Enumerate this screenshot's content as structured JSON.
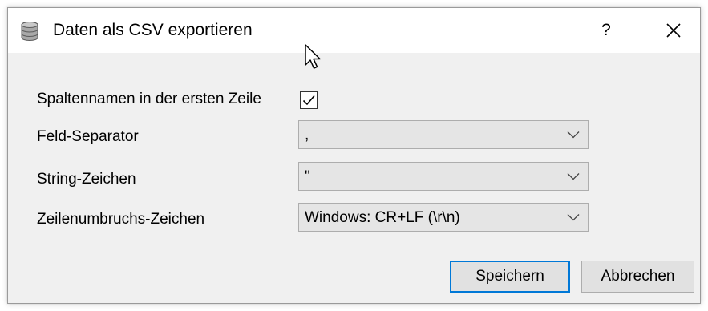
{
  "window": {
    "title": "Daten als CSV exportieren",
    "help_label": "?",
    "title_icon": "database-icon",
    "close_icon": "close-icon"
  },
  "form": {
    "header_row": {
      "label": "Spaltennamen in der ersten Zeile",
      "checked": true
    },
    "field_separator": {
      "label": "Feld-Separator",
      "value": ","
    },
    "string_char": {
      "label": "String-Zeichen",
      "value": "\""
    },
    "line_break": {
      "label": "Zeilenumbruchs-Zeichen",
      "value": "Windows: CR+LF (\\r\\n)"
    }
  },
  "buttons": {
    "save_label": "Speichern",
    "cancel_label": "Abbrechen"
  },
  "colors": {
    "accent": "#0078d7",
    "dialog_bg": "#f0f0f0",
    "combo_bg": "#e5e5e5"
  }
}
